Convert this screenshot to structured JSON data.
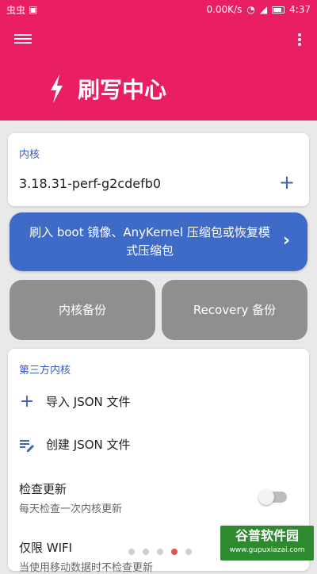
{
  "status_bar": {
    "left_glyphs": "虫虫",
    "network_speed": "0.00K/s",
    "time": "4:37"
  },
  "header": {
    "title": "刷写中心"
  },
  "kernel_card": {
    "title": "内核",
    "version": "3.18.31-perf-g2cdefb0",
    "add_symbol": "+"
  },
  "flash_button": {
    "label": "刷入 boot 镜像、AnyKernel 压缩包或恢复模式压缩包"
  },
  "backup_buttons": {
    "kernel_backup": "内核备份",
    "recovery_backup": "Recovery 备份"
  },
  "third_party": {
    "title": "第三方内核",
    "import_json": "导入 JSON 文件",
    "create_json": "创建 JSON 文件",
    "check_updates_title": "检查更新",
    "check_updates_sub": "每天检查一次内核更新",
    "wifi_only_title": "仅限 WIFI",
    "wifi_only_sub": "当使用移动数据时不检查更新"
  },
  "watermark": {
    "text": "谷普软件园",
    "url": "www.gupuxiazai.com"
  },
  "colors": {
    "accent": "#e91e63",
    "primary_button": "#3f6bc8",
    "gray_button": "#8f8f8f"
  }
}
